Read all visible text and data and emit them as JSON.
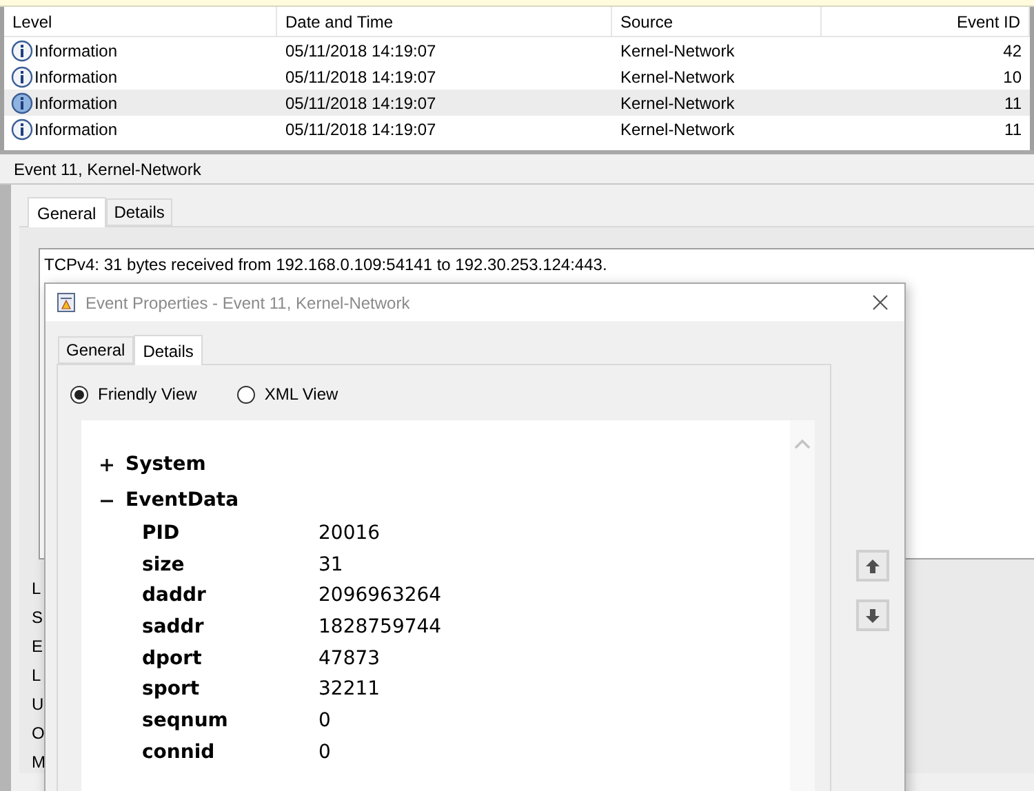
{
  "event_list": {
    "columns": [
      "Level",
      "Date and Time",
      "Source",
      "Event ID"
    ],
    "rows": [
      {
        "level": "Information",
        "date_time": "05/11/2018 14:19:07",
        "source": "Kernel-Network",
        "event_id": "42",
        "selected": false
      },
      {
        "level": "Information",
        "date_time": "05/11/2018 14:19:07",
        "source": "Kernel-Network",
        "event_id": "10",
        "selected": false
      },
      {
        "level": "Information",
        "date_time": "05/11/2018 14:19:07",
        "source": "Kernel-Network",
        "event_id": "11",
        "selected": true
      },
      {
        "level": "Information",
        "date_time": "05/11/2018 14:19:07",
        "source": "Kernel-Network",
        "event_id": "11",
        "selected": false
      }
    ]
  },
  "detail_pane": {
    "title": "Event 11, Kernel-Network",
    "tabs": [
      {
        "label": "General",
        "selected": true
      },
      {
        "label": "Details",
        "selected": false
      }
    ],
    "description": "TCPv4: 31 bytes received from 192.168.0.109:54141 to 192.30.253.124:443.",
    "field_labels": [
      "L",
      "S",
      "E",
      "L",
      "U",
      "O",
      "M"
    ]
  },
  "dialog": {
    "title": "Event Properties - Event 11, Kernel-Network",
    "tabs": [
      {
        "label": "General",
        "selected": false
      },
      {
        "label": "Details",
        "selected": true
      }
    ],
    "view_options": [
      {
        "label": "Friendly View",
        "selected": true
      },
      {
        "label": "XML View",
        "selected": false
      }
    ],
    "tree": [
      {
        "label": "System",
        "expanded": false
      },
      {
        "label": "EventData",
        "expanded": true,
        "children": [
          {
            "name": "PID",
            "value": "20016"
          },
          {
            "name": "size",
            "value": "31"
          },
          {
            "name": "daddr",
            "value": "2096963264"
          },
          {
            "name": "saddr",
            "value": "1828759744"
          },
          {
            "name": "dport",
            "value": "47873"
          },
          {
            "name": "sport",
            "value": "32211"
          },
          {
            "name": "seqnum",
            "value": "0"
          },
          {
            "name": "connid",
            "value": "0"
          }
        ]
      }
    ]
  }
}
